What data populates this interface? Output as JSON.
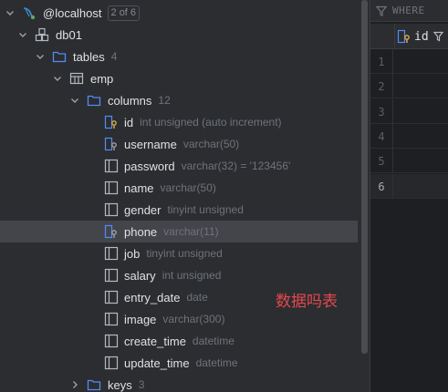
{
  "tree": {
    "connection": {
      "label": "@localhost",
      "badge": "2 of 6"
    },
    "database": {
      "label": "db01"
    },
    "tables_folder": {
      "label": "tables",
      "count": "4"
    },
    "table": {
      "label": "emp"
    },
    "columns_folder": {
      "label": "columns",
      "count": "12"
    },
    "columns": [
      {
        "name": "id",
        "type": "int unsigned (auto increment)",
        "key": "primary"
      },
      {
        "name": "username",
        "type": "varchar(50)",
        "key": "unique"
      },
      {
        "name": "password",
        "type": "varchar(32) = '123456'",
        "key": "none"
      },
      {
        "name": "name",
        "type": "varchar(50)",
        "key": "none"
      },
      {
        "name": "gender",
        "type": "tinyint unsigned",
        "key": "none"
      },
      {
        "name": "phone",
        "type": "varchar(11)",
        "key": "unique"
      },
      {
        "name": "job",
        "type": "tinyint unsigned",
        "key": "none"
      },
      {
        "name": "salary",
        "type": "int unsigned",
        "key": "none"
      },
      {
        "name": "entry_date",
        "type": "date",
        "key": "none"
      },
      {
        "name": "image",
        "type": "varchar(300)",
        "key": "none"
      },
      {
        "name": "create_time",
        "type": "datetime",
        "key": "none"
      },
      {
        "name": "update_time",
        "type": "datetime",
        "key": "none"
      }
    ],
    "keys_folder": {
      "label": "keys",
      "count": "3"
    },
    "selected_column": "phone"
  },
  "annotation": "数据吗表",
  "editor": {
    "filter_label": "WHERE",
    "column_header": "id",
    "row_numbers": [
      "1",
      "2",
      "3",
      "4",
      "5",
      "6"
    ],
    "active_row": "6"
  },
  "colors": {
    "folder": "#548af7",
    "key_gold": "#d5b048",
    "annotation": "#e5484d",
    "selection": "#43454a"
  }
}
